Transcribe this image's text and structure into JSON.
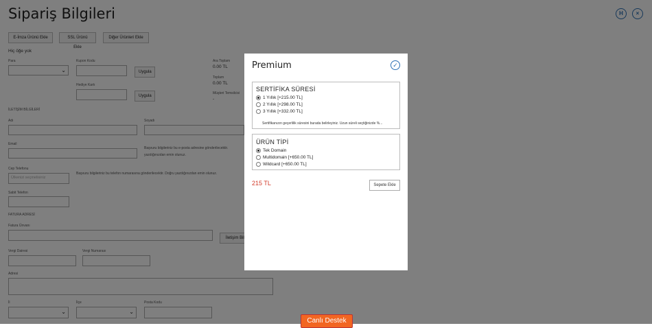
{
  "page": {
    "title": "Sipariş Bilgileri",
    "empty_note": "Hiç öğe yok"
  },
  "top_icons": {
    "help": "H",
    "close": "×"
  },
  "toolbar": {
    "esign": "E-İmza Ürünü Ekle",
    "ssl": "SSL Ürünü Ekle",
    "other": "Diğer Ürünleri Ekle"
  },
  "order": {
    "currency_label": "Para",
    "coupon_label": "Kupon Kodu",
    "apply_label": "Uygula",
    "gift_label": "Hediye Kartı",
    "apply2_label": "Uygula",
    "subtotal_label": "Ara Toplam",
    "subtotal_value": "0.00 TL",
    "total_label": "Toplam",
    "total_value": "0.00 TL",
    "rep_label": "Müşteri Temsilcisi",
    "rep_value": "-"
  },
  "contact": {
    "section": "İLETİŞİM BİLGİLERİ",
    "name_label": "Adı",
    "surname_label": "Soyadı",
    "email_label": "Email",
    "email_note": "Başvuru bilgileriniz bu e-posta adresine gönderilecektir.",
    "email_note2": "yazdığınızdan emin olunuz.",
    "phone_label": "Cep Telefonu",
    "phone_placeholder": "Ülkenizi seçmelisiniz",
    "phone_note": "Başvuru bilgileriniz bu telefon numarasına gönderilecektir. Doğru yazdığınızdan emin olunuz.",
    "landline_label": "Sabit Telefon"
  },
  "billing": {
    "section": "FATURA ADRESİ",
    "title_label": "Fatura Ünvanı",
    "copy_label": "İletişim Bilg",
    "tax_office_label": "Vergi Dairesi",
    "tax_no_label": "Vergi Numarası",
    "address_label": "Adresi",
    "city_label": "İl",
    "district_label": "İlçe",
    "postal_label": "Posta Kodu"
  },
  "modal": {
    "title": "Premium",
    "cert_title": "SERTİFİKA SÜRESİ",
    "cert_options": [
      "1 Yıllık [+215.00 TL]",
      "2 Yıllık [+298.00 TL]",
      "3 Yıllık [+332.00 TL]"
    ],
    "cert_desc": "Sertifikanızın geçerlilik süresini burada belirleyiniz. Uzun süreli seçtiğinizde %...",
    "type_title": "ÜRÜN TİPİ",
    "type_options": [
      "Tek Domain",
      "Multidomain [+650.00 TL]",
      "Wildcard [+650.00 TL]"
    ],
    "price": "215 TL",
    "add_to_cart": "Sepete Ekle"
  },
  "support": {
    "label": "Canlı Destek"
  },
  "colors": {
    "accent": "#2a6fb4",
    "price": "#d23b2a",
    "support": "#f26622"
  }
}
